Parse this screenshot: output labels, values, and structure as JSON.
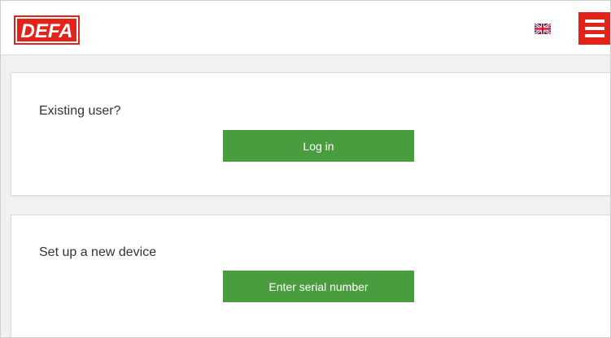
{
  "header": {
    "logo_text": "DEFA",
    "brand_color": "#e2231a",
    "language_flag": "uk-flag-icon",
    "menu_icon": "hamburger-menu-icon"
  },
  "existing_user": {
    "title": "Existing user?",
    "button_label": "Log in"
  },
  "new_device": {
    "title": "Set up a new device",
    "button_label": "Enter serial number"
  },
  "colors": {
    "accent_green": "#4a9d3e",
    "brand_red": "#e2231a"
  }
}
